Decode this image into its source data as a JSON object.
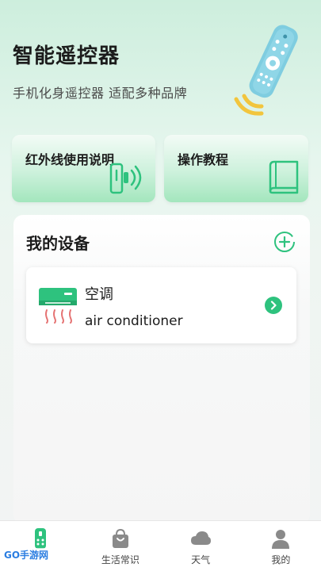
{
  "header": {
    "title": "智能遥控器",
    "subtitle": "手机化身遥控器 适配多种品牌",
    "illustration_icon": "remote-control-icon"
  },
  "quick_cards": [
    {
      "label": "红外线使用说明",
      "icon": "infrared-icon"
    },
    {
      "label": "操作教程",
      "icon": "book-icon"
    }
  ],
  "devices_panel": {
    "title": "我的设备",
    "add_icon": "plus-circle-icon",
    "devices": [
      {
        "name": "空调",
        "subtitle": "air conditioner",
        "icon": "air-conditioner-icon",
        "arrow_icon": "chevron-right-icon"
      }
    ]
  },
  "tabbar": {
    "items": [
      {
        "label": "",
        "icon": "remote-icon",
        "active": true
      },
      {
        "label": "生活常识",
        "icon": "bag-icon",
        "active": false
      },
      {
        "label": "天气",
        "icon": "cloud-icon",
        "active": false
      },
      {
        "label": "我的",
        "icon": "user-icon",
        "active": false
      }
    ],
    "watermark": "GO手游网"
  },
  "colors": {
    "accent": "#2ec27e",
    "card_gradient_bottom": "#a3e6bd",
    "remote_body": "#7fcde0",
    "signal_waves": "#f2c53d",
    "ac_red": "#e57373"
  }
}
